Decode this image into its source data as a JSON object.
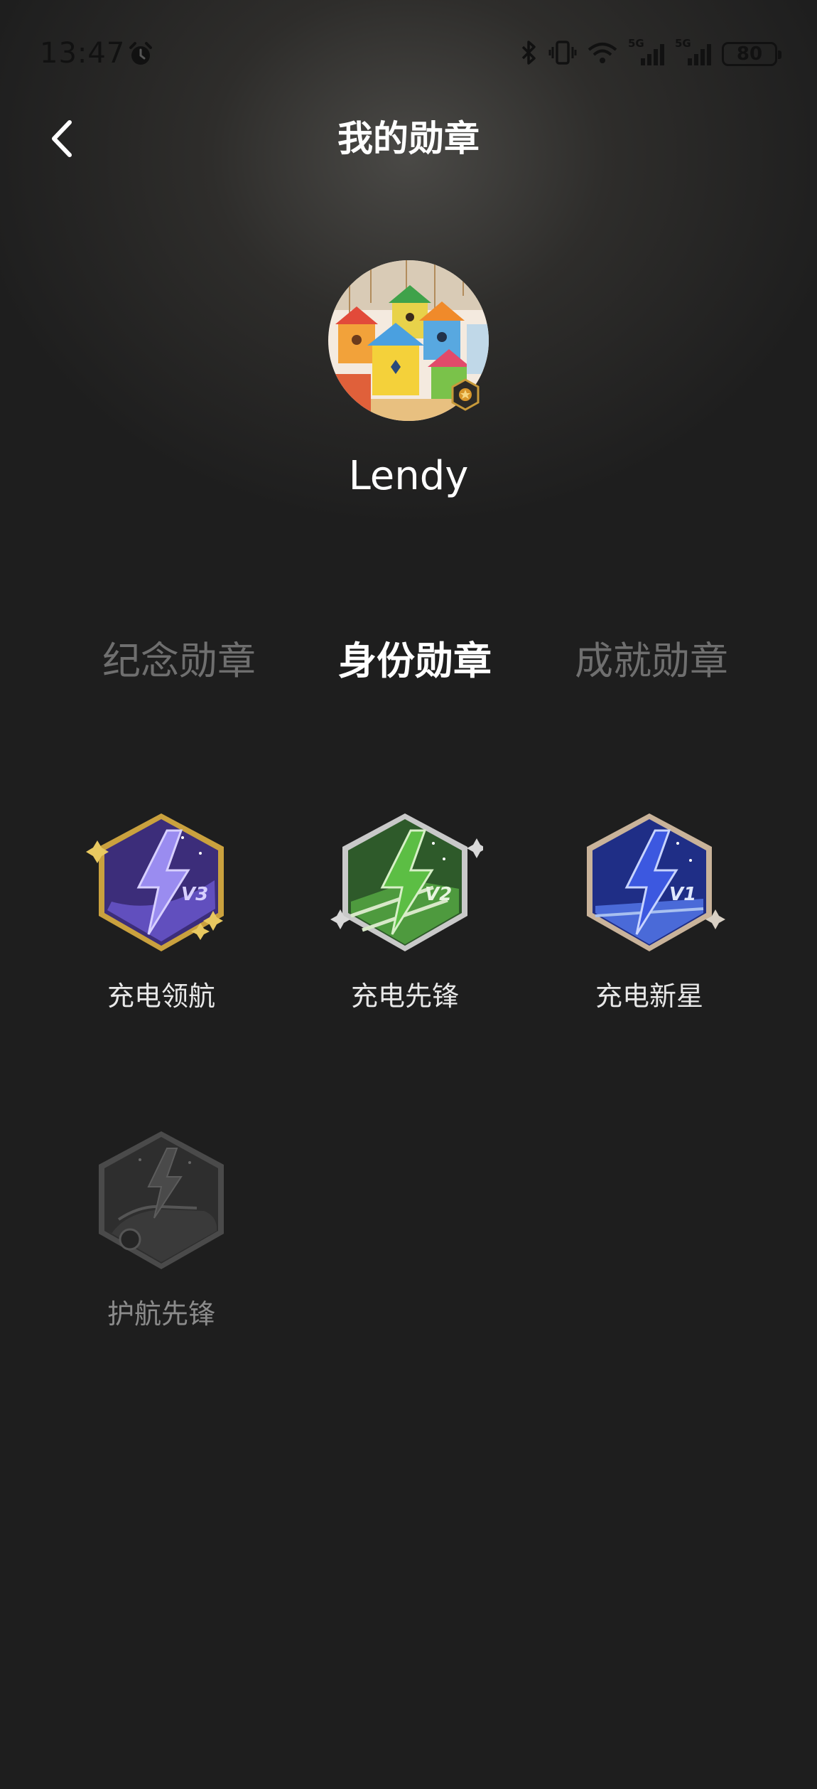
{
  "status_bar": {
    "time": "13:47",
    "network_1": "5G",
    "network_2": "5G",
    "battery": "80"
  },
  "header": {
    "title": "我的勋章"
  },
  "profile": {
    "username": "Lendy"
  },
  "tabs": [
    {
      "label": "纪念勋章",
      "active": false
    },
    {
      "label": "身份勋章",
      "active": true
    },
    {
      "label": "成就勋章",
      "active": false
    }
  ],
  "badges": [
    {
      "label": "充电领航",
      "level": "V3",
      "locked": false,
      "color": "#5a4fc9"
    },
    {
      "label": "充电先锋",
      "level": "V2",
      "locked": false,
      "color": "#3c9a3a"
    },
    {
      "label": "充电新星",
      "level": "V1",
      "locked": false,
      "color": "#2e49c8"
    },
    {
      "label": "护航先锋",
      "level": "",
      "locked": true,
      "color": "#3a3a3a"
    }
  ]
}
